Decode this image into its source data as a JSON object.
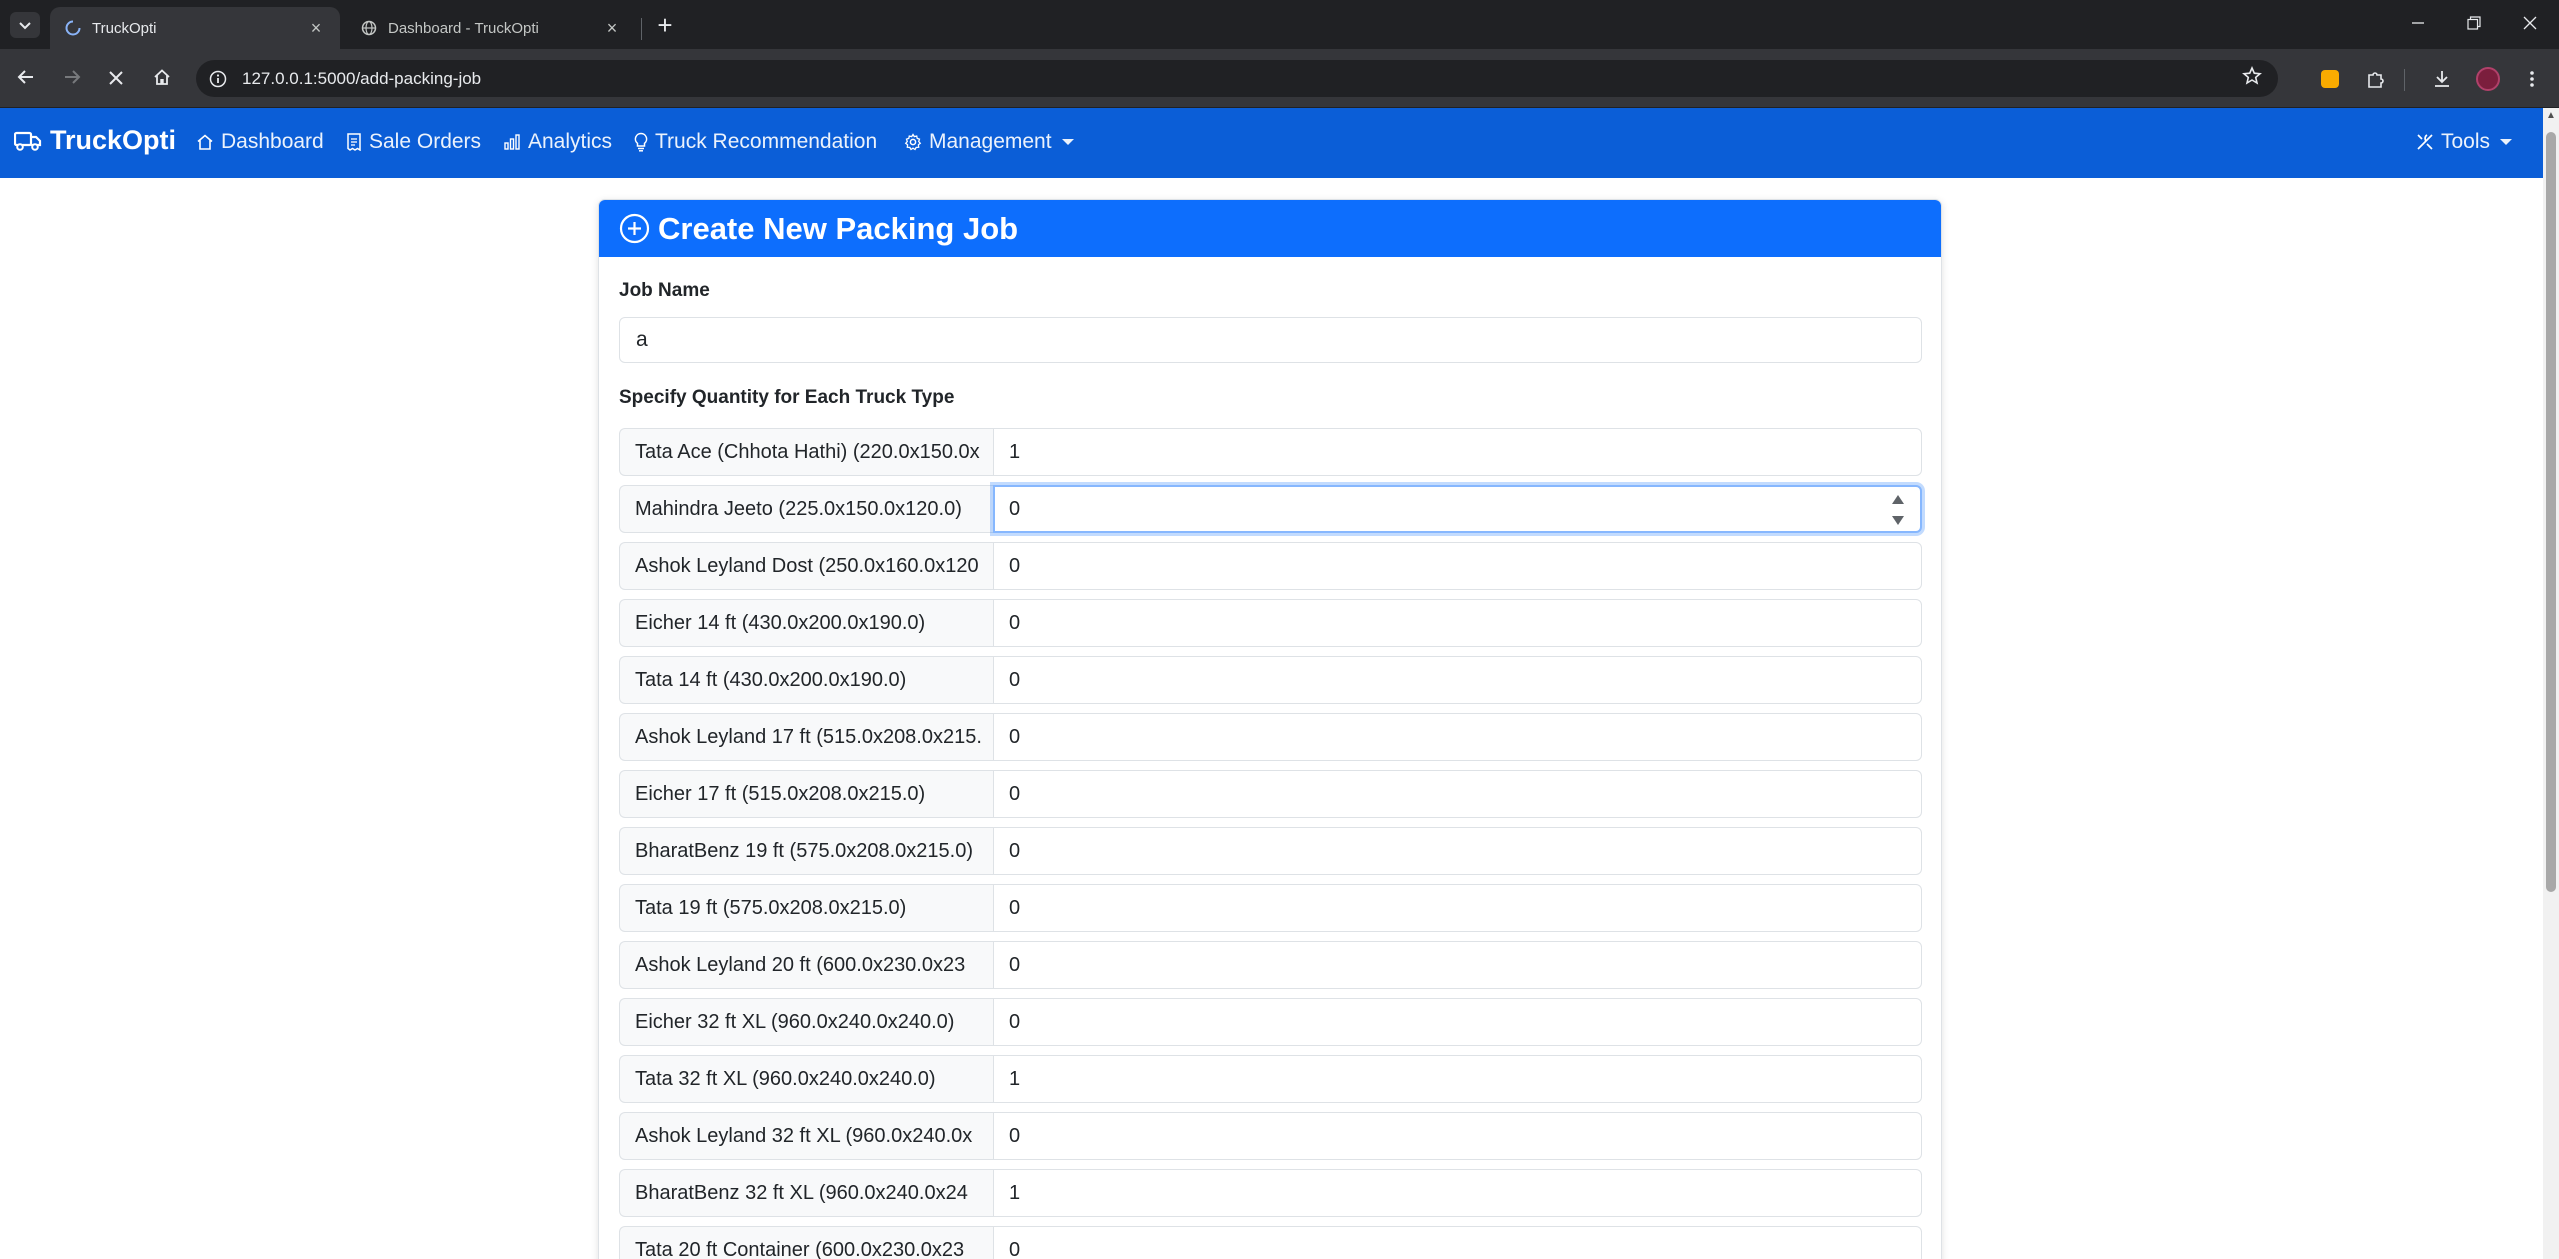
{
  "browser": {
    "tabs": [
      {
        "title": "TruckOpti",
        "active": true
      },
      {
        "title": "Dashboard - TruckOpti",
        "active": false
      }
    ],
    "url": "127.0.0.1:5000/add-packing-job"
  },
  "navbar": {
    "brand": "TruckOpti",
    "links": [
      "Dashboard",
      "Sale Orders",
      "Analytics",
      "Truck Recommendation",
      "Management"
    ],
    "tools": "Tools"
  },
  "form": {
    "title": "Create New Packing Job",
    "job_name_label": "Job Name",
    "job_name_value": "a",
    "quantity_label": "Specify Quantity for Each Truck Type",
    "trucks": [
      {
        "label": "Tata Ace (Chhota Hathi) (220.0x150.0x",
        "value": "1"
      },
      {
        "label": "Mahindra Jeeto (225.0x150.0x120.0)",
        "value": "0"
      },
      {
        "label": "Ashok Leyland Dost (250.0x160.0x120",
        "value": "0"
      },
      {
        "label": "Eicher 14 ft (430.0x200.0x190.0)",
        "value": "0"
      },
      {
        "label": "Tata 14 ft (430.0x200.0x190.0)",
        "value": "0"
      },
      {
        "label": "Ashok Leyland 17 ft (515.0x208.0x215.",
        "value": "0"
      },
      {
        "label": "Eicher 17 ft (515.0x208.0x215.0)",
        "value": "0"
      },
      {
        "label": "BharatBenz 19 ft (575.0x208.0x215.0)",
        "value": "0"
      },
      {
        "label": "Tata 19 ft (575.0x208.0x215.0)",
        "value": "0"
      },
      {
        "label": "Ashok Leyland 20 ft (600.0x230.0x23",
        "value": "0"
      },
      {
        "label": "Eicher 32 ft XL (960.0x240.0x240.0)",
        "value": "0"
      },
      {
        "label": "Tata 32 ft XL (960.0x240.0x240.0)",
        "value": "1"
      },
      {
        "label": "Ashok Leyland 32 ft XL (960.0x240.0x",
        "value": "0"
      },
      {
        "label": "BharatBenz 32 ft XL (960.0x240.0x24",
        "value": "1"
      },
      {
        "label": "Tata 20 ft Container (600.0x230.0x23",
        "value": "0"
      }
    ]
  }
}
